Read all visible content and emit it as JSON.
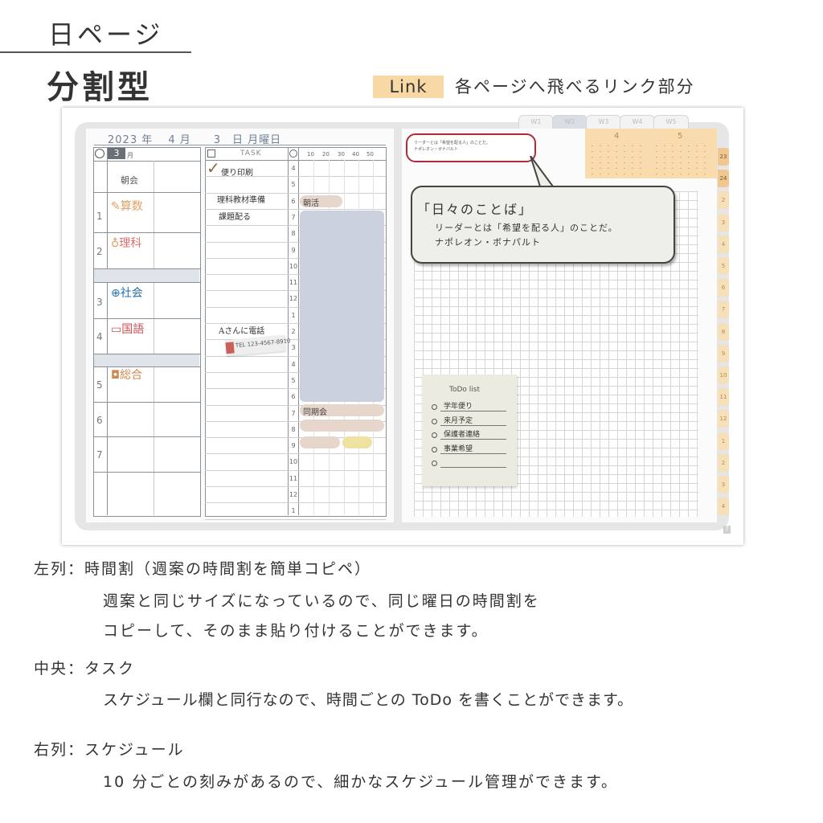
{
  "header": {
    "title": "日ページ",
    "subtitle": "分割型",
    "link_label": "Link",
    "link_description": "各ページへ飛べるリンク部分"
  },
  "planner": {
    "date_line": "2023 年　 4 月　　3　日 月曜日",
    "week_tabs": [
      "W1",
      "W2",
      "W3",
      "W4",
      "W5"
    ],
    "timetable": {
      "month_box": "3",
      "month_unit": "月",
      "morning": "朝会",
      "periods": [
        "1",
        "2",
        "3",
        "4",
        "5",
        "6",
        "7"
      ],
      "subjects": [
        {
          "name": "算数",
          "icon": "pencil-icon",
          "color": "#e0a060"
        },
        {
          "name": "理科",
          "icon": "bulb-icon",
          "color": "#e07070"
        },
        {
          "name": "社会",
          "icon": "globe-icon",
          "color": "#1f6fb0"
        },
        {
          "name": "国語",
          "icon": "book-icon",
          "color": "#d05050"
        },
        {
          "name": "総合",
          "icon": "camera-icon",
          "color": "#d08a50"
        }
      ]
    },
    "task": {
      "header": "TASK",
      "items": [
        "便り印刷",
        "理科教材準備",
        "課題配る",
        "Aさんに電話"
      ],
      "tel_note": "TEL 123-4567-8910"
    },
    "schedule": {
      "minute_marks": [
        "10",
        "20",
        "30",
        "40",
        "50"
      ],
      "hours": [
        "4",
        "5",
        "6",
        "7",
        "8",
        "9",
        "10",
        "11",
        "12",
        "1",
        "2",
        "3",
        "4",
        "5",
        "6",
        "7",
        "8",
        "9",
        "10",
        "11",
        "12",
        "1"
      ],
      "events": [
        "朝活",
        "同期会"
      ]
    },
    "quote": {
      "small_text_line1": "リーダーとは「希望を配る人」のことだ。",
      "small_text_line2": "ナポレオン・ボナパルト",
      "title": "「日々のことば」",
      "body": "リーダーとは「希望を配る人」のことだ。",
      "author": "ナポレオン・ボナパルト"
    },
    "mini_calendar": {
      "months": [
        "4",
        "5"
      ]
    },
    "side_tabs": [
      "23",
      "24",
      "2",
      "3",
      "4",
      "5",
      "6",
      "7",
      "8",
      "9",
      "10",
      "11",
      "12",
      "1",
      "2",
      "3",
      "4"
    ],
    "todo": {
      "title": "ToDo list",
      "items": [
        "学年便り",
        "来月予定",
        "保護者連絡",
        "事業希望",
        ""
      ]
    }
  },
  "descriptions": [
    {
      "head": "左列：時間割（週案の時間割を簡単コピペ）",
      "lines": [
        "週案と同じサイズになっているので、同じ曜日の時間割を",
        "コピーして、そのまま貼り付けることができます。"
      ]
    },
    {
      "head": "中央：タスク",
      "lines": [
        "スケジュール欄と同行なので、時間ごとの ToDo を書くことができます。"
      ]
    },
    {
      "head": "右列：スケジュール",
      "lines": [
        "10 分ごとの刻みがあるので、細かなスケジュール管理ができます。"
      ]
    }
  ]
}
